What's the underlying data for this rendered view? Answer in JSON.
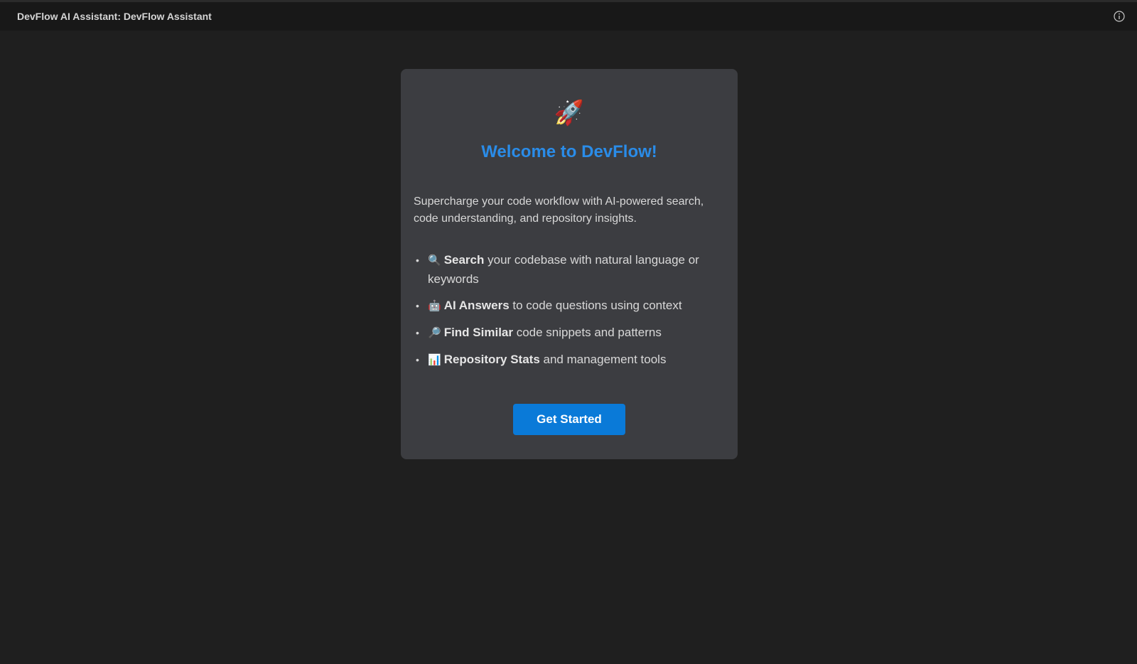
{
  "window": {
    "title": "DevFlow AI Assistant: DevFlow Assistant",
    "info_icon": "info-circle-icon"
  },
  "welcome": {
    "hero_icon": "🚀",
    "heading": "Welcome to DevFlow!",
    "intro": "Supercharge your code workflow with AI-powered search, code understanding, and repository insights.",
    "features": [
      {
        "icon": "🔍",
        "bold": "Search",
        "text": " your codebase with natural language or keywords"
      },
      {
        "icon": "🤖",
        "bold": "AI Answers",
        "text": " to code questions using context"
      },
      {
        "icon": "🔎",
        "bold": "Find Similar",
        "text": " code snippets and patterns"
      },
      {
        "icon": "📊",
        "bold": "Repository Stats",
        "text": " and management tools"
      }
    ],
    "cta_label": "Get Started"
  },
  "colors": {
    "background": "#1f1f1f",
    "titlebar": "#181818",
    "card": "#3c3d41",
    "accent": "#2a8ce8",
    "button": "#0a7ad8"
  }
}
